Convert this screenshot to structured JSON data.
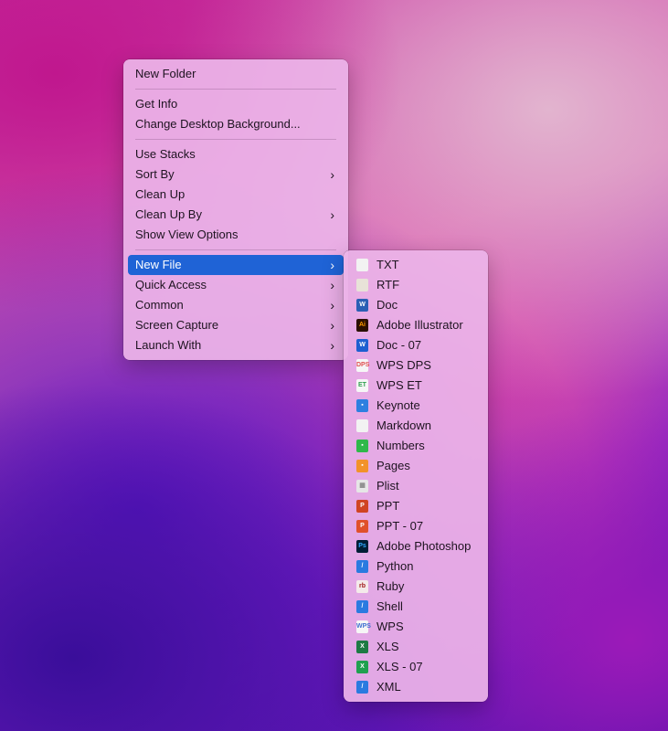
{
  "main_menu": {
    "groups": [
      [
        {
          "label": "New Folder"
        }
      ],
      [
        {
          "label": "Get Info"
        },
        {
          "label": "Change Desktop Background..."
        }
      ],
      [
        {
          "label": "Use Stacks"
        },
        {
          "label": "Sort By",
          "submenu": true
        },
        {
          "label": "Clean Up"
        },
        {
          "label": "Clean Up By",
          "submenu": true
        },
        {
          "label": "Show View Options"
        }
      ],
      [
        {
          "label": "New File",
          "submenu": true,
          "selected": true
        },
        {
          "label": "Quick Access",
          "submenu": true
        },
        {
          "label": "Common",
          "submenu": true
        },
        {
          "label": "Screen Capture",
          "submenu": true
        },
        {
          "label": "Launch With",
          "submenu": true
        }
      ]
    ],
    "chevron": "›",
    "selection_color": "#1f63d6"
  },
  "new_file_submenu": {
    "items": [
      {
        "label": "TXT",
        "icon": "txt-file-icon",
        "color": "#f2f2f2",
        "glyph": "",
        "fg": "#999"
      },
      {
        "label": "RTF",
        "icon": "rtf-file-icon",
        "color": "#e8e2d8",
        "glyph": "",
        "fg": "#a06020"
      },
      {
        "label": "Doc",
        "icon": "word-doc-icon",
        "color": "#2b5fb4",
        "glyph": "W"
      },
      {
        "label": "Adobe Illustrator",
        "icon": "illustrator-icon",
        "color": "#2b1000",
        "glyph": "Ai",
        "fg": "#ff9a00"
      },
      {
        "label": "Doc - 07",
        "icon": "word-docx-icon",
        "color": "#1e5fd0",
        "glyph": "W"
      },
      {
        "label": "WPS DPS",
        "icon": "wps-dps-icon",
        "color": "#f6f6f6",
        "glyph": "DPS",
        "fg": "#e05050"
      },
      {
        "label": "WPS ET",
        "icon": "wps-et-icon",
        "color": "#f6f6f6",
        "glyph": "ET",
        "fg": "#30a050"
      },
      {
        "label": "Keynote",
        "icon": "keynote-icon",
        "color": "#2d7fe0",
        "glyph": "▪"
      },
      {
        "label": "Markdown",
        "icon": "markdown-file-icon",
        "color": "#f2f2f2",
        "glyph": "",
        "fg": "#999"
      },
      {
        "label": "Numbers",
        "icon": "numbers-icon",
        "color": "#2fb84a",
        "glyph": "▪"
      },
      {
        "label": "Pages",
        "icon": "pages-icon",
        "color": "#f2922a",
        "glyph": "▪"
      },
      {
        "label": "Plist",
        "icon": "plist-file-icon",
        "color": "#e6e6e6",
        "glyph": "▦",
        "fg": "#888"
      },
      {
        "label": "PPT",
        "icon": "powerpoint-icon",
        "color": "#d04423",
        "glyph": "P"
      },
      {
        "label": "PPT - 07",
        "icon": "powerpoint-pptx-icon",
        "color": "#e0502a",
        "glyph": "P"
      },
      {
        "label": "Adobe Photoshop",
        "icon": "photoshop-icon",
        "color": "#001e36",
        "glyph": "Ps",
        "fg": "#31a8ff"
      },
      {
        "label": "Python",
        "icon": "python-file-icon",
        "color": "#2a7ae0",
        "glyph": "/"
      },
      {
        "label": "Ruby",
        "icon": "ruby-file-icon",
        "color": "#f4eaea",
        "glyph": "rb",
        "fg": "#a01818"
      },
      {
        "label": "Shell",
        "icon": "shell-file-icon",
        "color": "#2a7ae0",
        "glyph": "/"
      },
      {
        "label": "WPS",
        "icon": "wps-file-icon",
        "color": "#f6f6f6",
        "glyph": "WPS",
        "fg": "#4070d0"
      },
      {
        "label": "XLS",
        "icon": "excel-icon",
        "color": "#1d7a44",
        "glyph": "X"
      },
      {
        "label": "XLS - 07",
        "icon": "excel-xlsx-icon",
        "color": "#20a050",
        "glyph": "X"
      },
      {
        "label": "XML",
        "icon": "xml-file-icon",
        "color": "#2a7ae0",
        "glyph": "/"
      }
    ]
  }
}
